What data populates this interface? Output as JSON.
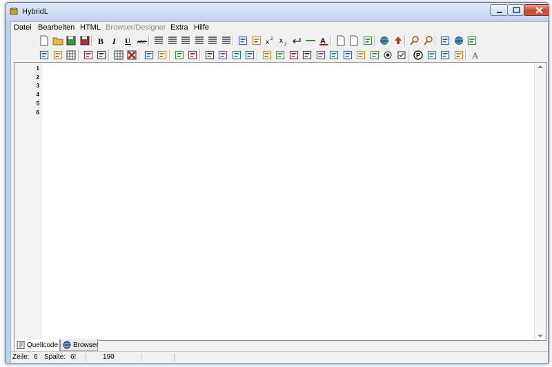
{
  "window": {
    "title": "HybridL"
  },
  "menu": [
    {
      "label": "Datei",
      "enabled": true
    },
    {
      "label": "Bearbeiten",
      "enabled": true
    },
    {
      "label": "HTML",
      "enabled": true
    },
    {
      "label": "Browser/Designer",
      "enabled": false
    },
    {
      "label": "Extra",
      "enabled": true
    },
    {
      "label": "Hilfe",
      "enabled": true
    }
  ],
  "toolbar1": [
    "new-file-icon",
    "open-file-icon",
    "save-icon",
    "save-as-icon",
    "bold-icon",
    "italic-icon",
    "underline-icon",
    "strikethrough-icon",
    "bullet-list-icon",
    "numbered-list-icon",
    "align-left-icon",
    "align-center-icon",
    "justify-icon",
    "align-right-icon",
    "indent-icon",
    "outdent-icon",
    "superscript-icon",
    "subscript-icon",
    "line-break-icon",
    "horizontal-rule-icon",
    "font-color-icon",
    "comment-icon",
    "document-icon",
    "link-icon",
    "globe-icon",
    "upload-icon",
    "zoom-in-icon",
    "zoom-out-icon",
    "color-picker-icon",
    "internet-icon",
    "image-icon"
  ],
  "toolbar2": [
    "layout-icon",
    "frame-icon",
    "grid-icon",
    "form-icon",
    "panel-icon",
    "table-icon",
    "delete-table-icon",
    "merge-cells-icon",
    "split-cells-icon",
    "insert-row-icon",
    "insert-column-icon",
    "column-left-icon",
    "column-right-icon",
    "row-above-icon",
    "row-below-icon",
    "div-icon",
    "span-icon",
    "textbox-icon",
    "image-button-icon",
    "hidden-field-icon",
    "textarea-icon",
    "fieldset-icon",
    "select-icon",
    "button-icon",
    "radio-icon",
    "checkbox-icon",
    "paragraph-icon",
    "edit-icon",
    "tag-icon",
    "remove-tag-icon",
    "font-icon"
  ],
  "editor": {
    "line_numbers": [
      "1",
      "2",
      "3",
      "4",
      "5",
      "6"
    ]
  },
  "tabs": [
    {
      "label": "Quellcode",
      "icon": "source-code-icon",
      "active": true
    },
    {
      "label": "Browser",
      "icon": "browser-icon",
      "active": false
    }
  ],
  "status": {
    "line_label": "Zeile:",
    "line_value": "6",
    "column_label": "Spalte:",
    "column_value": "6!",
    "length_value": "190"
  }
}
